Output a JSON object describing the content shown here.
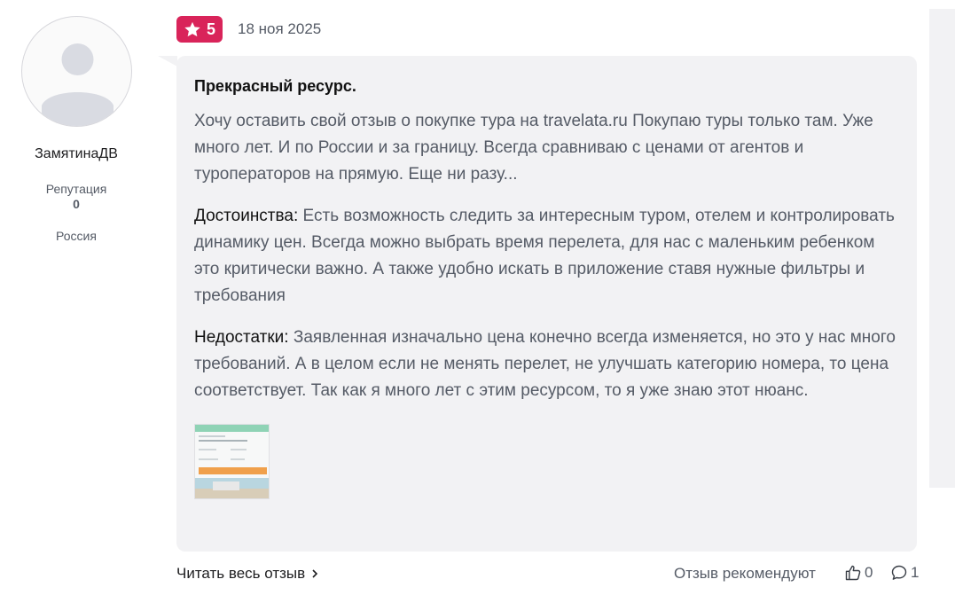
{
  "user": {
    "name": "ЗамятинаДВ",
    "reputation_label": "Репутация",
    "reputation_value": "0",
    "country": "Россия"
  },
  "review": {
    "rating": "5",
    "date": "18 ноя 2025",
    "title": "Прекрасный ресурс.",
    "text": "Хочу оставить свой отзыв о покупке тура на travelata.ru Покупаю туры только там. Уже много лет. И по России и за границу. Всегда сравниваю с ценами от агентов и туроператоров на прямую. Еще ни разу...",
    "pros_label": "Достоинства:",
    "pros_text": "Есть возможность следить за интересным туром, отелем и контролировать динамику цен. Всегда можно выбрать время перелета, для нас с маленьким ребенком это критически важно. А также удобно искать в приложение ставя нужные фильтры и требования",
    "cons_label": "Недостатки:",
    "cons_text": "Заявленная изначально цена конечно всегда изменяется, но это у нас много требований. А в целом если не менять перелет, не улучшать категорию номера, то цена соответствует. Так как я много лет с этим ресурсом, то я уже знаю этот нюанс."
  },
  "footer": {
    "read_more": "Читать весь отзыв",
    "recommend_label": "Отзыв рекомендуют",
    "likes_count": "0",
    "comments_count": "1"
  },
  "colors": {
    "badge": "#d9245a",
    "bubble": "#f2f2f4",
    "muted_text": "#555b66"
  },
  "icons": {
    "rating": "star-icon",
    "read_more": "chevron-right-icon",
    "likes": "thumbs-up-icon",
    "comments": "comment-icon",
    "avatar": "user-silhouette-icon"
  }
}
